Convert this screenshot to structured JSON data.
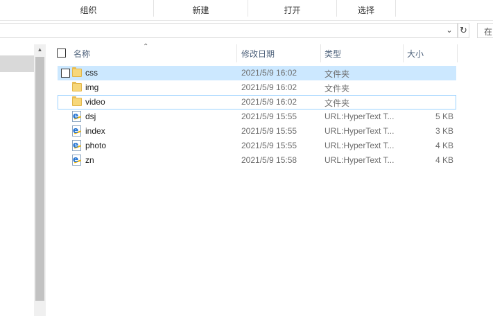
{
  "ribbon": {
    "organize": "组织",
    "new": "新建",
    "open": "打开",
    "select": "选择"
  },
  "addressbar": {
    "path": "",
    "dropdown_icon": "chevron-down-icon",
    "refresh_icon": "refresh-icon",
    "search_placeholder": "在"
  },
  "columns": {
    "name": "名称",
    "date": "修改日期",
    "type": "类型",
    "size": "大小"
  },
  "files": [
    {
      "name": "css",
      "date": "2021/5/9 16:02",
      "type": "文件夹",
      "size": "",
      "icon": "folder-icon"
    },
    {
      "name": "img",
      "date": "2021/5/9 16:02",
      "type": "文件夹",
      "size": "",
      "icon": "folder-icon"
    },
    {
      "name": "video",
      "date": "2021/5/9 16:02",
      "type": "文件夹",
      "size": "",
      "icon": "folder-icon"
    },
    {
      "name": "dsj",
      "date": "2021/5/9 15:55",
      "type": "URL:HyperText T...",
      "size": "5 KB",
      "icon": "html-file-icon"
    },
    {
      "name": "index",
      "date": "2021/5/9 15:55",
      "type": "URL:HyperText T...",
      "size": "3 KB",
      "icon": "html-file-icon"
    },
    {
      "name": "photo",
      "date": "2021/5/9 15:55",
      "type": "URL:HyperText T...",
      "size": "4 KB",
      "icon": "html-file-icon"
    },
    {
      "name": "zn",
      "date": "2021/5/9 15:58",
      "type": "URL:HyperText T...",
      "size": "4 KB",
      "icon": "html-file-icon"
    }
  ],
  "colors": {
    "selection": "#cce8ff",
    "focus_border": "#99d1ff",
    "header_text": "#4c607a",
    "folder": "#f7d77a"
  }
}
